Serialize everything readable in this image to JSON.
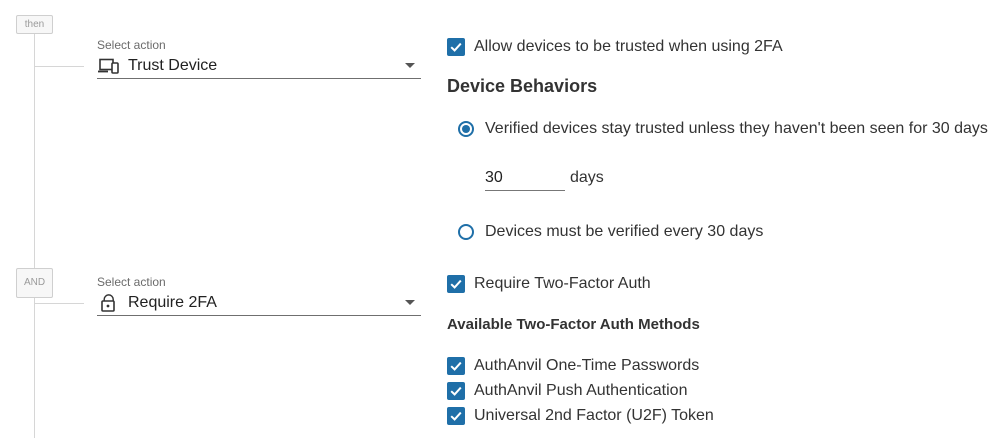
{
  "connectors": {
    "then_label": "then",
    "and_label": "AND"
  },
  "action1": {
    "select_label": "Select action",
    "value": "Trust Device",
    "icon": "devices-icon"
  },
  "action2": {
    "select_label": "Select action",
    "value": "Require 2FA",
    "icon": "lock-icon"
  },
  "trust_settings": {
    "allow_trust_label": "Allow devices to be trusted when using 2FA",
    "allow_trust_checked": true,
    "behaviors_heading": "Device Behaviors",
    "radio_stay_trusted": "Verified devices stay trusted unless they haven't been seen for 30 days",
    "radio_stay_trusted_selected": true,
    "days_value": "30",
    "days_unit": "days",
    "radio_reverify": "Devices must be verified every 30 days",
    "radio_reverify_selected": false
  },
  "twofa_settings": {
    "require_label": "Require Two-Factor Auth",
    "require_checked": true,
    "methods_heading": "Available Two-Factor Auth Methods",
    "methods": [
      {
        "label": "AuthAnvil One-Time Passwords",
        "checked": true
      },
      {
        "label": "AuthAnvil Push Authentication",
        "checked": true
      },
      {
        "label": "Universal 2nd Factor (U2F) Token",
        "checked": true
      }
    ]
  },
  "colors": {
    "accent": "#1f6fa8",
    "line": "#d6d6d6"
  }
}
